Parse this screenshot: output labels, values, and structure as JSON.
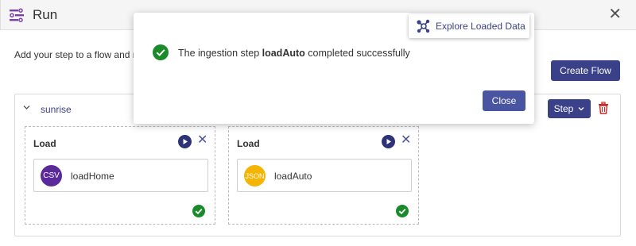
{
  "header": {
    "title": "Run",
    "close_glyph": "✕",
    "icon": "flow-run-icon"
  },
  "intro_text": "Add your step to a flow and ru",
  "create_flow_label": "Create Flow",
  "flow": {
    "name": "sunrise",
    "step_button_label": "Step",
    "cards": [
      {
        "title": "Load",
        "step_name": "loadHome",
        "badge": "CSV",
        "badge_color": "#5b2a9a",
        "status": "success"
      },
      {
        "title": "Load",
        "step_name": "loadAuto",
        "badge": "JSON",
        "badge_color": "#f4b400",
        "status": "success"
      }
    ]
  },
  "toast": {
    "explore_label": "Explore Loaded Data",
    "message_prefix": "The ingestion step ",
    "step_name": "loadAuto",
    "message_suffix": " completed successfully",
    "close_label": "Close"
  },
  "colors": {
    "primary": "#3a4188",
    "success": "#1a8a2b",
    "danger": "#c62828"
  }
}
